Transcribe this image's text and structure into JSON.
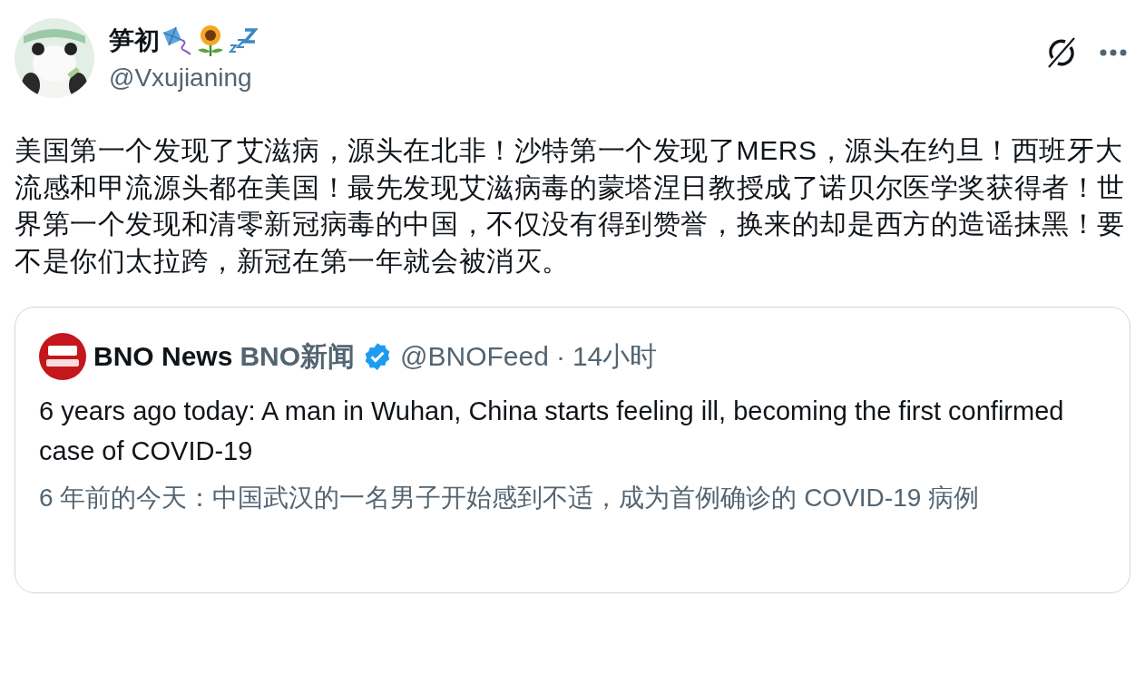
{
  "author": {
    "name": "笋初",
    "handle": "@Vxujianing"
  },
  "post": {
    "text": "美国第一个发现了艾滋病，源头在北非！沙特第一个发现了MERS，源头在约旦！西班牙大流感和甲流源头都在美国！最先发现艾滋病毒的蒙塔涅日教授成了诺贝尔医学奖获得者！世界第一个发现和清零新冠病毒的中国，不仅没有得到赞誉，换来的却是西方的造谣抹黑！要不是你们太拉跨，新冠在第一年就会被消灭。"
  },
  "quoted_post": {
    "name": "BNO News",
    "alt_name": "BNO新闻",
    "verified": true,
    "handle": "@BNOFeed",
    "separator": "·",
    "time": "14小时",
    "text": "6 years ago today: A man in Wuhan, China starts feeling ill, becoming the first confirmed case of COVID-19",
    "translation": "6 年前的今天：中国武汉的一名男子开始感到不适，成为首例确诊的 COVID-19 病例"
  }
}
